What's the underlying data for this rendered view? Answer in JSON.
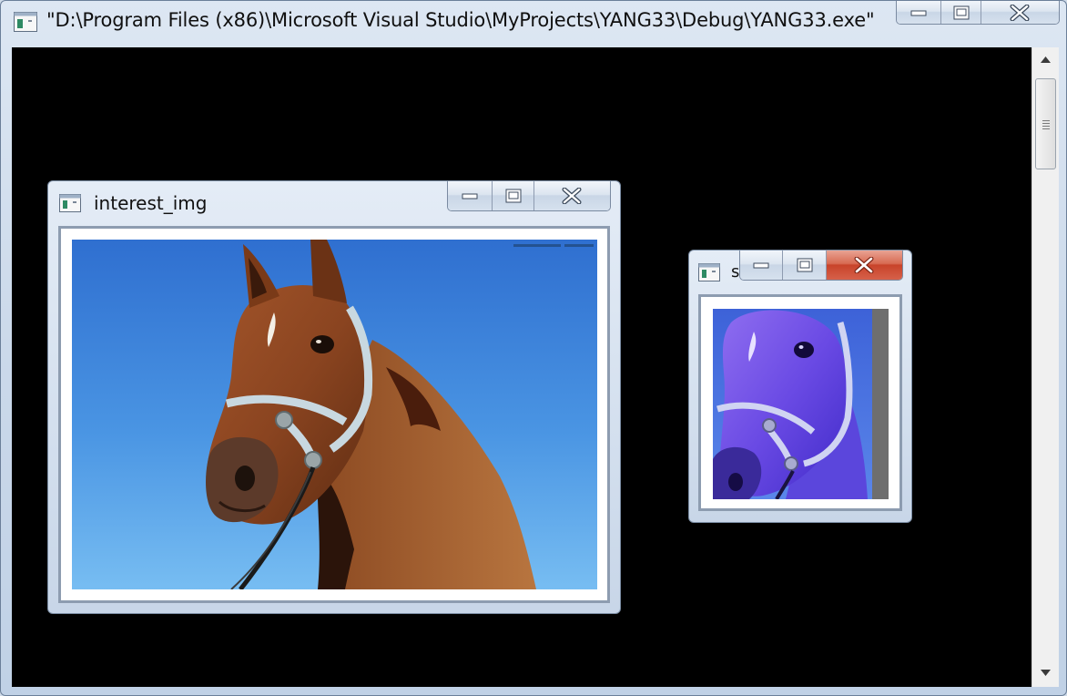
{
  "console": {
    "title": "\"D:\\Program Files (x86)\\Microsoft Visual Studio\\MyProjects\\YANG33\\Debug\\YANG33.exe\"",
    "app_icon": "console-window-icon",
    "caption_buttons": [
      "minimize-icon",
      "maximize-icon",
      "close-icon"
    ],
    "background_color": "#000000"
  },
  "windows": {
    "interest": {
      "title": "interest_img",
      "icon": "app-window-icon",
      "image": "brown-horse-with-halter-against-blue-sky"
    },
    "small": {
      "title": "s",
      "icon": "app-window-icon",
      "image": "horse-head-blue-tinted",
      "close_state": "hover-red"
    }
  },
  "colors": {
    "frame": "#cbd9ea",
    "sky": "#3f8be0",
    "horse": "#8a4a24",
    "close_hover": "#c8432a",
    "tint": "#5b3ee8"
  }
}
